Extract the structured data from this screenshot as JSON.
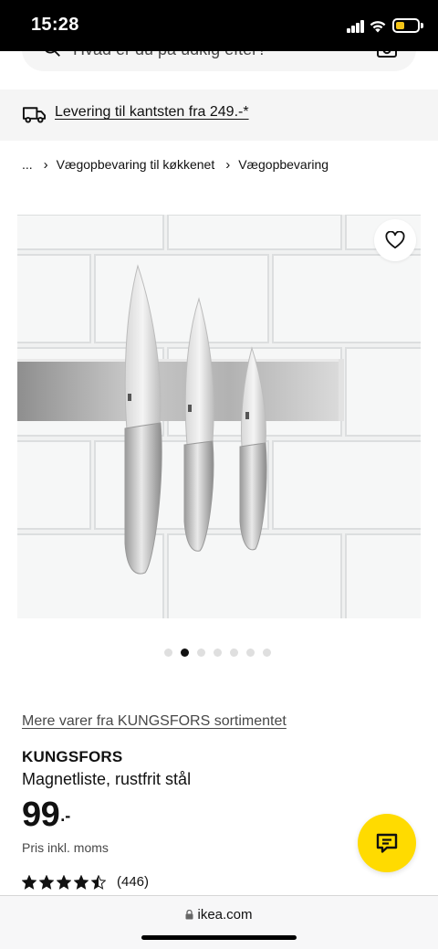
{
  "status_bar": {
    "time": "15:28"
  },
  "search": {
    "placeholder": "Hvad er du på udkig efter?"
  },
  "delivery_banner": {
    "text": "Levering til kantsten fra 249.-*"
  },
  "breadcrumb": {
    "items": [
      "...",
      "Vægopbevaring til køkkenet",
      "Vægopbevaring"
    ]
  },
  "gallery": {
    "total_images": 7,
    "active_index": 1
  },
  "product": {
    "range_link": "Mere varer fra KUNGSFORS sortimentet",
    "name": "KUNGSFORS",
    "description": "Magnetliste, rustfrit stål",
    "price_integer": "99",
    "price_decimal": ".-",
    "price_note": "Pris inkl. moms",
    "rating_value": 4.5,
    "rating_count": "(446)"
  },
  "browser": {
    "url": "ikea.com"
  },
  "colors": {
    "accent_yellow": "#ffdb00",
    "text": "#111111",
    "muted_text": "#484848",
    "banner_bg": "#f5f5f5"
  },
  "icons": {
    "search": "search-icon",
    "camera": "camera-icon",
    "truck": "truck-icon",
    "favorite": "heart-icon",
    "chat": "chat-icon",
    "lock": "lock-icon"
  }
}
